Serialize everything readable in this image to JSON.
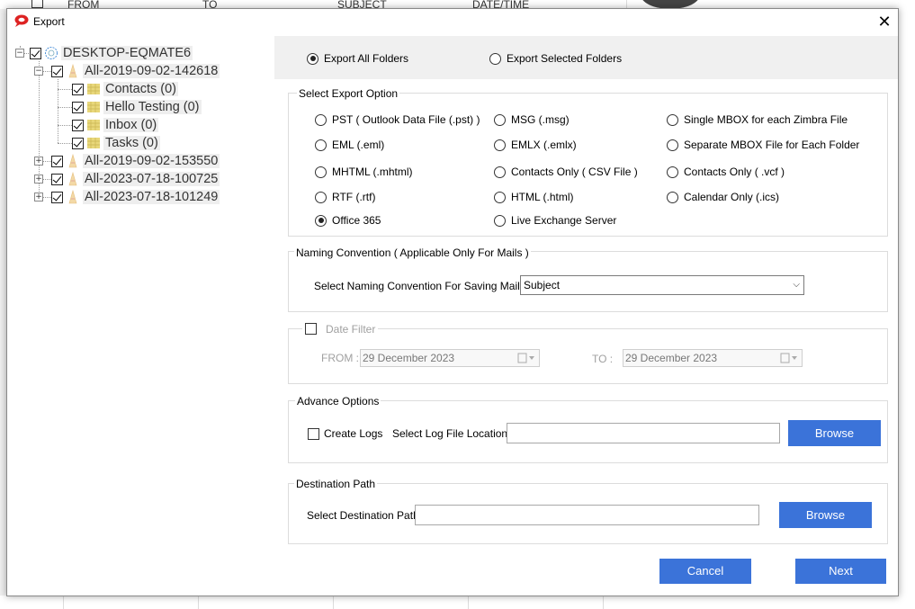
{
  "background": {
    "columns": [
      "FROM",
      "TO",
      "SUBJECT",
      "DATE/TIME"
    ]
  },
  "window": {
    "title": "Export",
    "close_label": "✕"
  },
  "tree": {
    "root": "DESKTOP-EQMATE6",
    "accounts": [
      {
        "label": "All-2019-09-02-142618",
        "expanded": true,
        "folders": [
          "Contacts (0)",
          "Hello Testing (0)",
          "Inbox (0)",
          "Tasks (0)"
        ]
      },
      {
        "label": "All-2019-09-02-153550",
        "expanded": false
      },
      {
        "label": "All-2023-07-18-100725",
        "expanded": false
      },
      {
        "label": "All-2023-07-18-101249",
        "expanded": false
      }
    ]
  },
  "scope": {
    "all": "Export All Folders",
    "selected": "Export Selected Folders",
    "value": "all"
  },
  "export_options": {
    "title": "Select Export Option",
    "options": [
      "PST ( Outlook Data File (.pst) )",
      "MSG  (.msg)",
      "Single MBOX for each Zimbra File",
      "EML  (.eml)",
      "EMLX  (.emlx)",
      "Separate MBOX File for Each Folder",
      "MHTML (.mhtml)",
      "Contacts Only  ( CSV File )",
      "Contacts Only  ( .vcf )",
      "RTF  (.rtf)",
      "HTML  (.html)",
      "Calendar Only  (.ics)",
      "Office 365",
      "Live Exchange Server"
    ],
    "selected": "Office 365"
  },
  "naming": {
    "title": "Naming Convention ( Applicable Only For Mails )",
    "label": "Select Naming Convention For Saving Mails",
    "value": "Subject"
  },
  "date_filter": {
    "title": "Date Filter",
    "from_label": "FROM :",
    "from_value": "29 December 2023",
    "to_label": "TO :",
    "to_value": "29 December 2023"
  },
  "advance": {
    "title": "Advance Options",
    "create_logs": "Create Logs",
    "log_location_label": "Select Log File Location :",
    "browse": "Browse"
  },
  "destination": {
    "title": "Destination Path",
    "label": "Select Destination Path",
    "browse": "Browse"
  },
  "footer": {
    "cancel": "Cancel",
    "next": "Next"
  },
  "colors": {
    "button": "#3b73d9",
    "panel": "#f0f0f0"
  }
}
